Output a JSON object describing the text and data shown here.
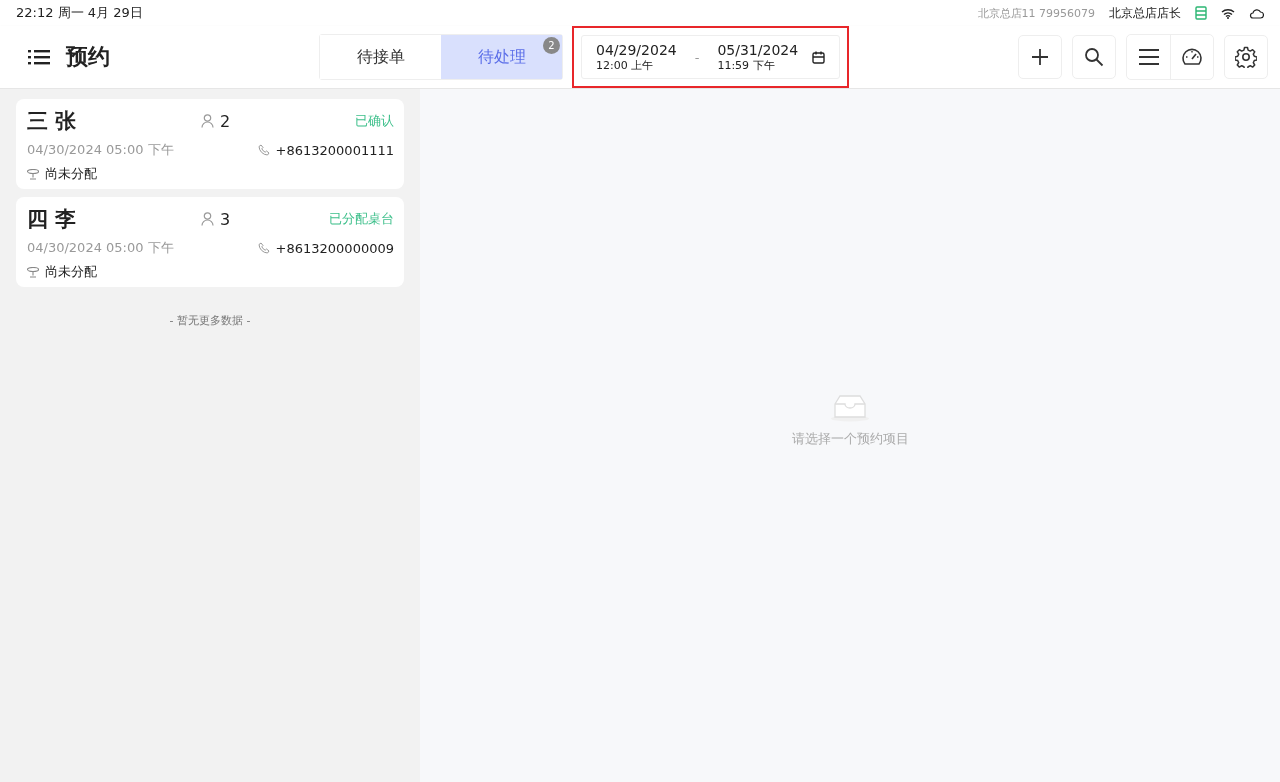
{
  "status_bar": {
    "time": "22:12 周一 4月 29日",
    "store_code": "北京总店11  79956079",
    "user": "北京总店店长"
  },
  "header": {
    "title": "预约",
    "tabs": [
      {
        "label": "待接单",
        "selected": false
      },
      {
        "label": "待处理",
        "selected": true,
        "badge": "2"
      }
    ],
    "date_range": {
      "start_date": "04/29/2024",
      "start_time": "12:00 上午",
      "separator": "-",
      "end_date": "05/31/2024",
      "end_time": "11:59 下午"
    }
  },
  "reservations": [
    {
      "name": "三 张",
      "guests": "2",
      "status": "已确认",
      "time": "04/30/2024 05:00 下午",
      "phone": "+8613200001111",
      "table": "尚未分配"
    },
    {
      "name": "四 李",
      "guests": "3",
      "status": "已分配桌台",
      "time": "04/30/2024 05:00 下午",
      "phone": "+8613200000009",
      "table": "尚未分配"
    }
  ],
  "list_end": "- 暂无更多数据 -",
  "empty_state": "请选择一个预约项目"
}
